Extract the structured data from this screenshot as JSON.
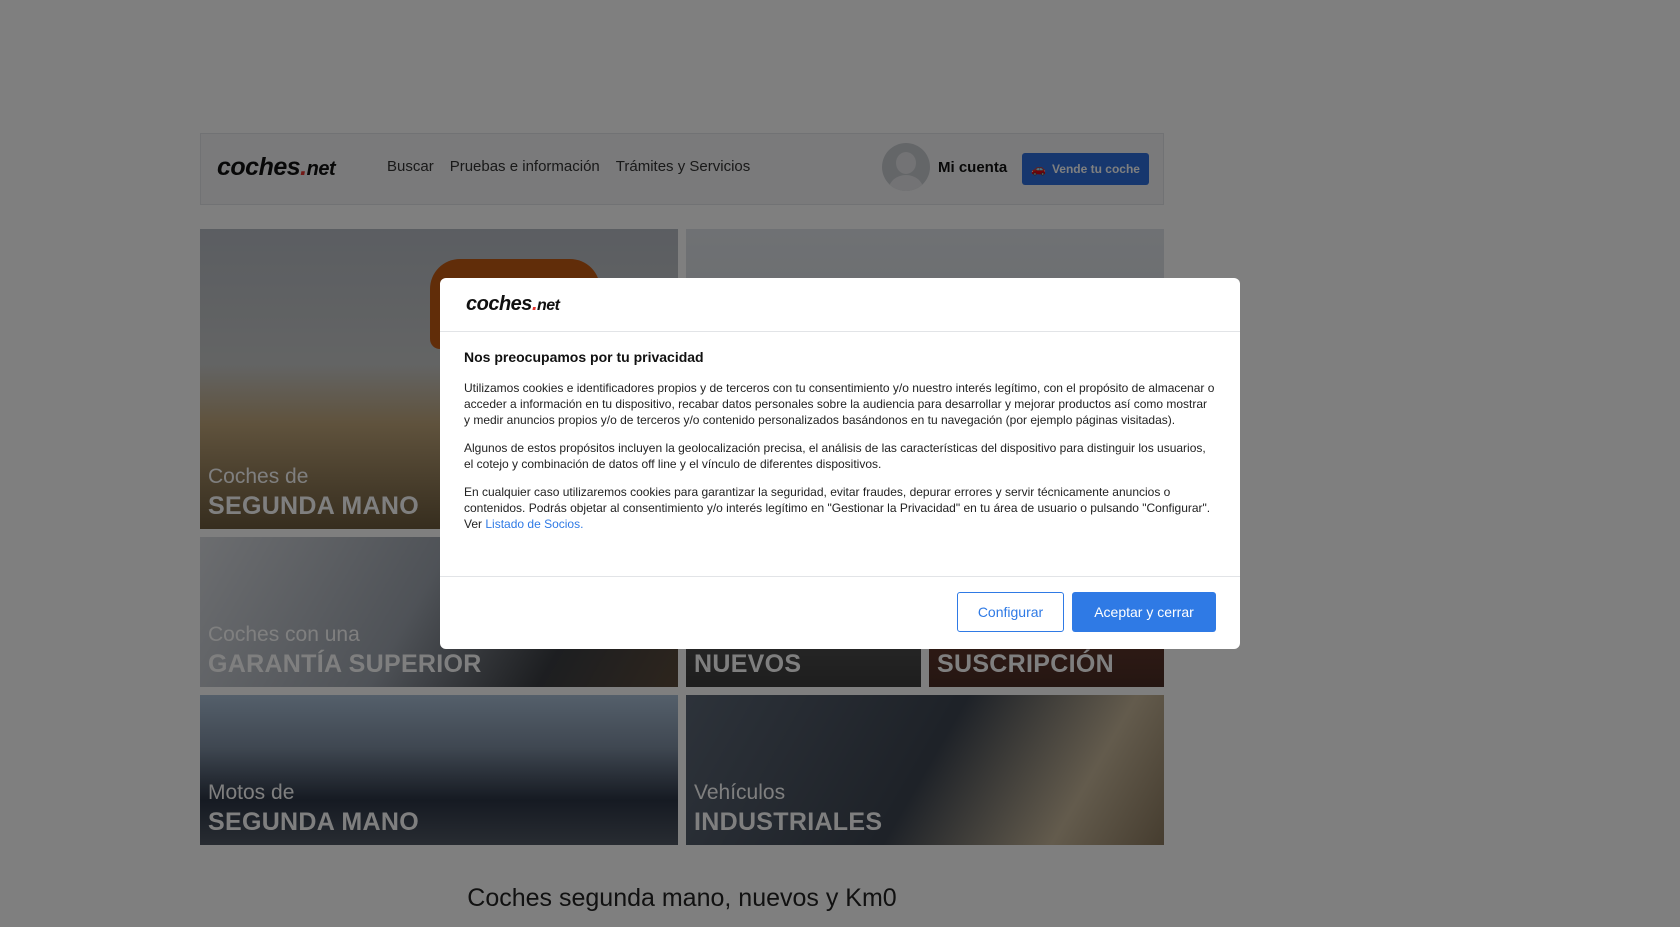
{
  "header": {
    "logo": {
      "main": "coches",
      "dot": ".",
      "suffix": "net"
    },
    "nav": [
      "Buscar",
      "Pruebas e información",
      "Trámites y Servicios"
    ],
    "account_label": "Mi cuenta",
    "sell_button": "Vende tu coche",
    "sell_icon": "car-plus-icon"
  },
  "tiles": {
    "used_cars": {
      "line1": "Coches de",
      "line2": "SEGUNDA MANO"
    },
    "warranty": {
      "line1": "Coches con una",
      "line2": "GARANTÍA SUPERIOR"
    },
    "new_cars": {
      "line2": "NUEVOS"
    },
    "subscription": {
      "line2": "SUSCRIPCIÓN"
    },
    "motos": {
      "line1": "Motos de",
      "line2": "SEGUNDA MANO"
    },
    "industrial": {
      "line1": "Vehículos",
      "line2": "INDUSTRIALES"
    }
  },
  "page_heading": "Coches segunda mano, nuevos y Km0",
  "modal": {
    "logo": {
      "main": "coches",
      "dot": ".",
      "suffix": "net"
    },
    "title": "Nos preocupamos por tu privacidad",
    "paragraph1": "Utilizamos cookies e identificadores propios y de terceros con tu consentimiento y/o nuestro interés legítimo, con el propósito de almacenar o acceder a información en tu dispositivo, recabar datos personales sobre la audiencia para desarrollar y mejorar productos así como mostrar y medir anuncios propios y/o de terceros y/o contenido personalizados basándonos en tu navegación (por ejemplo páginas visitadas).",
    "paragraph2": "Algunos de estos propósitos incluyen la geolocalización precisa, el análisis de las características del dispositivo para distinguir los usuarios, el cotejo y combinación de datos off line y el vínculo de diferentes dispositivos.",
    "paragraph3": "En cualquier caso utilizaremos cookies para garantizar la seguridad, evitar fraudes, depurar errores y servir técnicamente anuncios o contenidos. Podrás objetar al consentimiento y/o interés legítimo en \"Gestionar la Privacidad\" en tu área de usuario o pulsando \"Configurar\". Ver",
    "partners_link": "Listado de Socios.",
    "configure_button": "Configurar",
    "accept_button": "Aceptar y cerrar"
  },
  "colors": {
    "accent": "#2f7ae5",
    "brand_dot": "#e5322d",
    "sell_button": "#2f6fdc"
  }
}
